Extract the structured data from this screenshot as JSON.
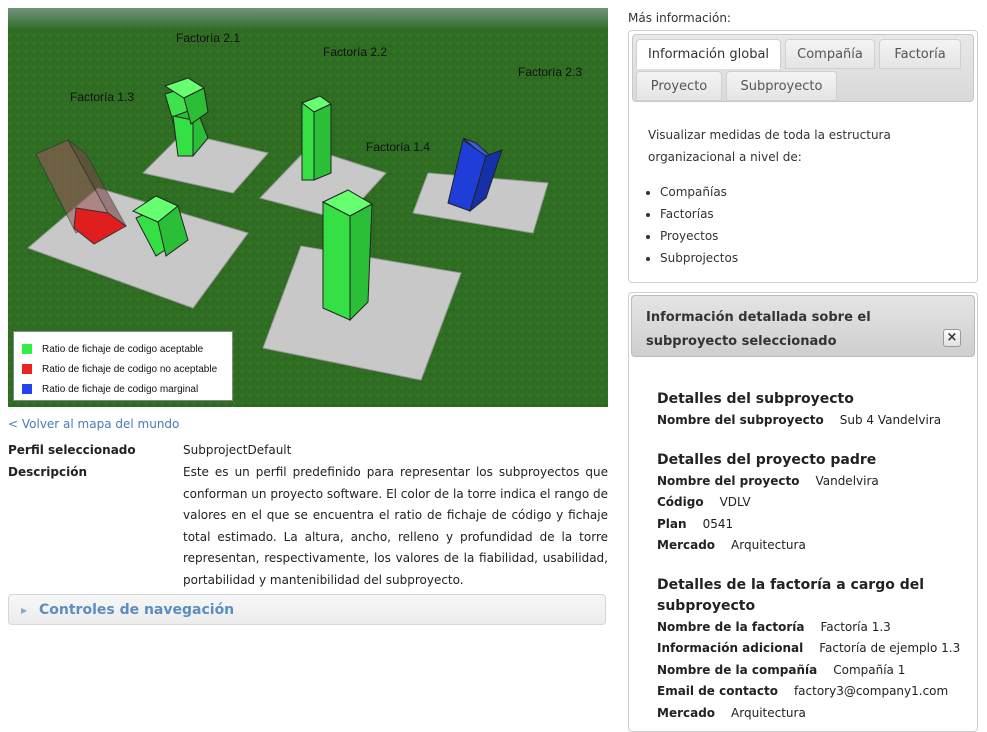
{
  "scene": {
    "factories": [
      {
        "label": "Factoría 2.1"
      },
      {
        "label": "Factoría 2.2"
      },
      {
        "label": "Factoría 2.3"
      },
      {
        "label": "Factoría 1.3"
      },
      {
        "label": "Factoría 1.4"
      }
    ],
    "legend": [
      {
        "label": "Ratio de fichaje de codigo aceptable",
        "color": "#33ee44"
      },
      {
        "label": "Ratio de fichaje de codigo no aceptable",
        "color": "#ee2222"
      },
      {
        "label": "Ratio de fichaje de codigo marginal",
        "color": "#2244ee"
      }
    ]
  },
  "back_link": "< Volver al mapa del mundo",
  "profile": {
    "label": "Perfil seleccionado",
    "value": "SubprojectDefault",
    "desc_label": "Descripción",
    "description": "Este es un perfil predefinido para representar los subproyectos que conforman un proyecto software. El color de la torre indica el rango de valores en el que se encuentra el ratio de fichaje de código y fichaje total estimado. La altura, ancho, relleno y profundidad de la torre representan, respectivamente, los valores de la fiabilidad, usabilidad, portabilidad y mantenibilidad del subproyecto."
  },
  "nav_controls": "Controles de navegación",
  "more_info": {
    "label": "Más información:",
    "tabs": [
      {
        "label": "Información global"
      },
      {
        "label": "Compañía"
      },
      {
        "label": "Factoría"
      },
      {
        "label": "Proyecto"
      },
      {
        "label": "Subproyecto"
      }
    ],
    "active_tab": "Información global",
    "text": "Visualizar medidas de toda la estructura organizacional a nivel de:",
    "items": [
      "Compañías",
      "Factorías",
      "Proyectos",
      "Subprojectos"
    ]
  },
  "detail": {
    "title": "Información detallada sobre el subproyecto seleccionado",
    "close": "×",
    "subproject": {
      "title": "Detalles del subproyecto",
      "name_label": "Nombre del subproyecto",
      "name": "Sub 4 Vandelvira"
    },
    "parent": {
      "title": "Detalles del proyecto padre",
      "name_label": "Nombre del proyecto",
      "name": "Vandelvira",
      "code_label": "Código",
      "code": "VDLV",
      "plan_label": "Plan",
      "plan": "0541",
      "market_label": "Mercado",
      "market": "Arquitectura"
    },
    "factory": {
      "title": "Detalles de la factoría a cargo del subproyecto",
      "name_label": "Nombre de la factoría",
      "name": "Factoría 1.3",
      "info_label": "Información adicional",
      "info": "Factoría de ejemplo 1.3",
      "company_label": "Nombre de la compañía",
      "company": "Compañía 1",
      "email_label": "Email de contacto",
      "email": "factory3@company1.com",
      "market_label": "Mercado",
      "market": "Arquitectura"
    }
  }
}
